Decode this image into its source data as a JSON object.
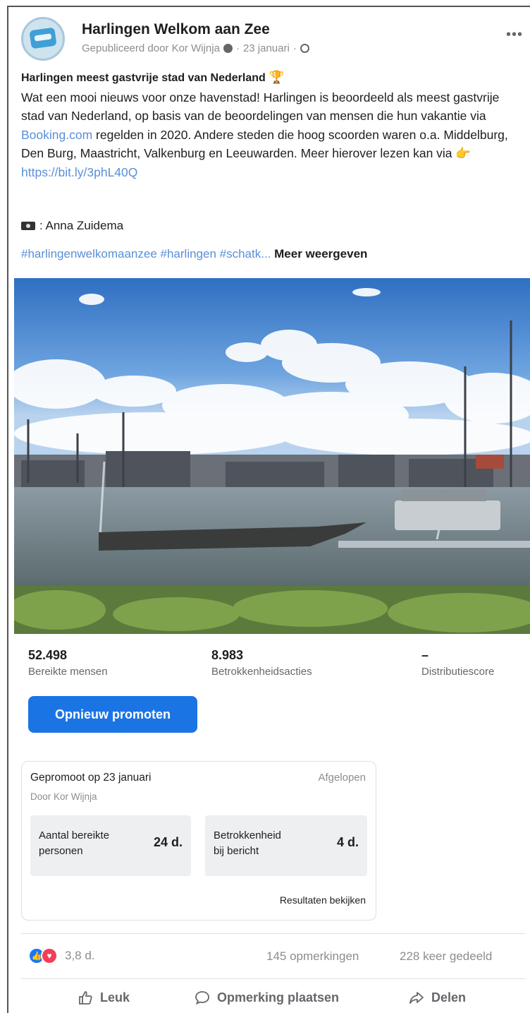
{
  "post": {
    "page_name": "Harlingen Welkom aan Zee",
    "meta": "Gepubliceerd door Kor Wijnja",
    "date": "23 januari",
    "title": "Harlingen meest gastvrije stad van Nederland",
    "body_part1": "Wat een mooi nieuws voor onze havenstad! Harlingen is beoordeeld als meest gastvrije stad van Nederland, op basis van de beoordelingen van mensen die hun vakantie via ",
    "body_link": "Booking.com",
    "body_part2": " regelden in 2020. Andere steden die hoog scoorden waren o.a. Middelburg, Den Burg, Maastricht, Valkenburg en Leeuwarden. Meer hierover lezen kan via ",
    "url": "https://bit.ly/3phL40Q",
    "photo_credit": ": Anna Zuidema",
    "hashtags": "#harlingenwelkomaanzee #harlingen #schatk...",
    "more_label": "Meer weergeven",
    "more_icon": "ellipsis-icon"
  },
  "stats": {
    "reach_value": "52.498",
    "reach_label": "Bereikte mensen",
    "engagement_value": "8.983",
    "engagement_label": "Betrokkenheidsacties",
    "distribution_value": "–",
    "distribution_label": "Distributiescore"
  },
  "promote_button": "Opnieuw promoten",
  "promotion": {
    "title": "Gepromoot op 23 januari",
    "status": "Afgelopen",
    "by": "Door Kor Wijnja",
    "metric1_label_line1": "Aantal bereikte",
    "metric1_label_line2": "personen",
    "metric1_value": "24 d.",
    "metric2_label_line1": "Betrokkenheid",
    "metric2_label_line2": "bij bericht",
    "metric2_value": "4 d.",
    "results_link": "Resultaten bekijken"
  },
  "engagement": {
    "reactions": "3,8 d.",
    "comments": "145 opmerkingen",
    "shares": "228 keer gedeeld"
  },
  "actions": {
    "like": "Leuk",
    "comment": "Opmerking plaatsen",
    "share": "Delen"
  },
  "colors": {
    "accent": "#1b74e4",
    "link": "#5a8fd8",
    "like": "#1877f2",
    "love": "#f33e58"
  }
}
